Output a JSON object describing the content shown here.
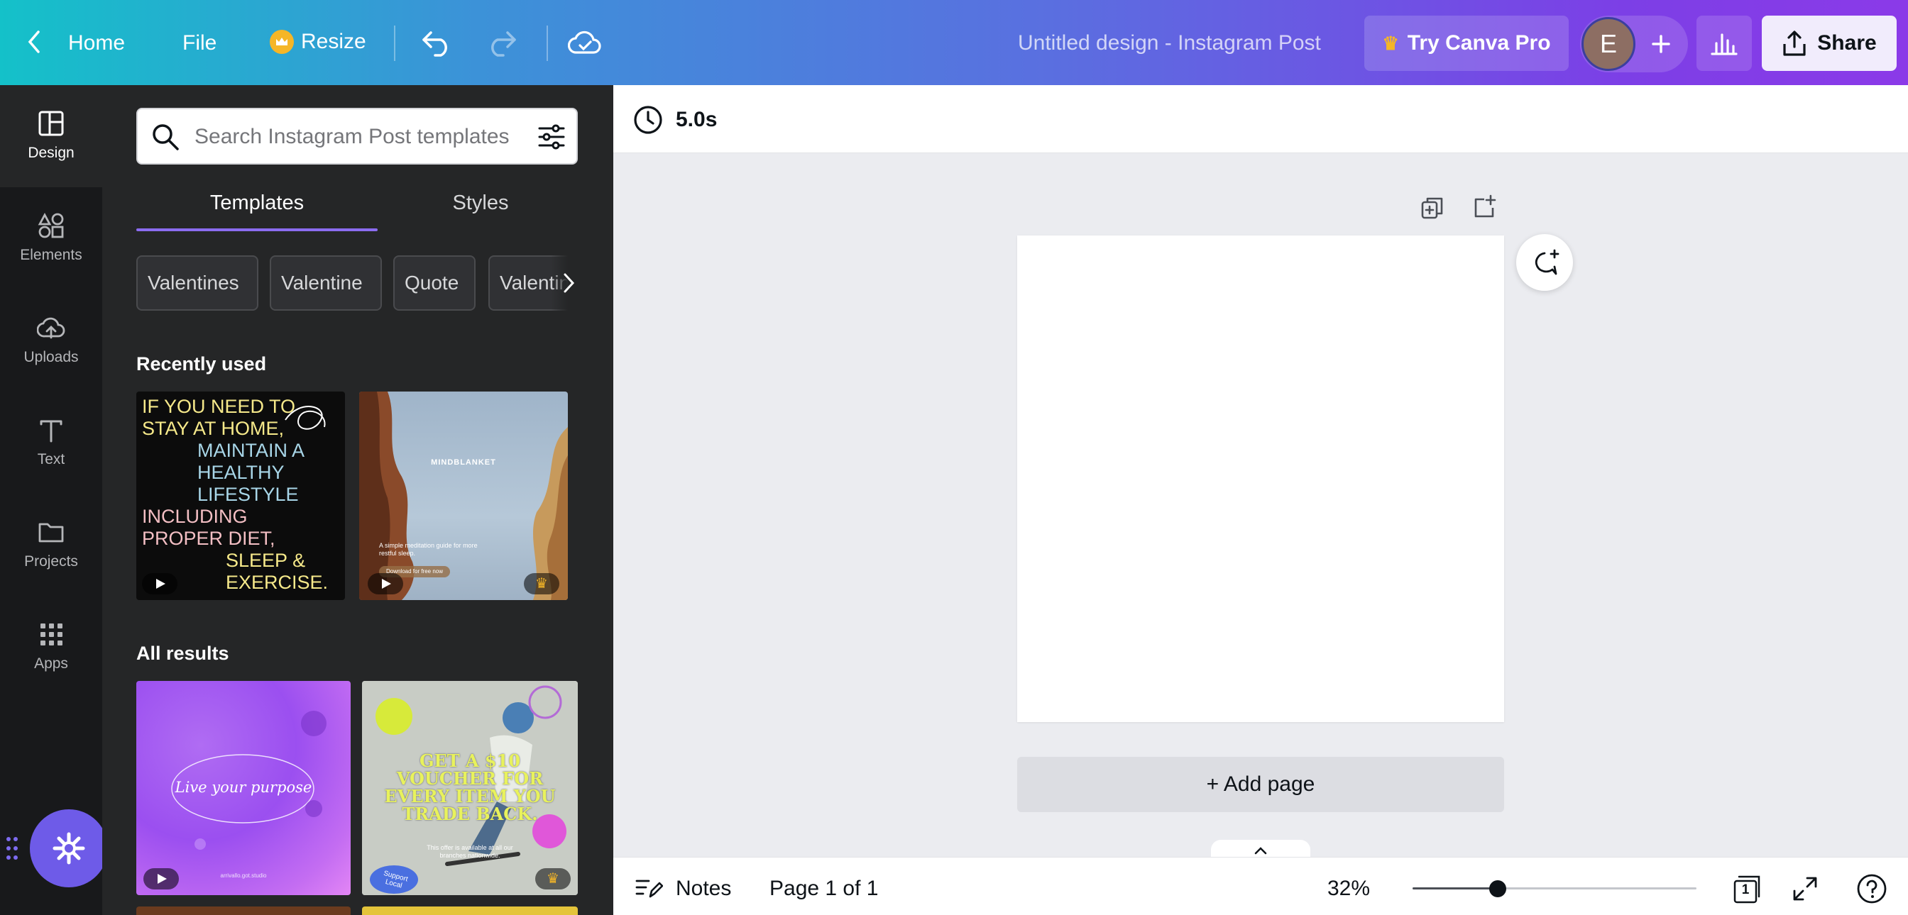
{
  "topbar": {
    "home_label": "Home",
    "file_label": "File",
    "resize_label": "Resize",
    "doc_title": "Untitled design - Instagram Post",
    "try_pro_label": "Try Canva Pro",
    "avatar_initial": "E",
    "share_label": "Share"
  },
  "rail": {
    "items": [
      {
        "label": "Design",
        "icon": "layout-icon"
      },
      {
        "label": "Elements",
        "icon": "shapes-icon"
      },
      {
        "label": "Uploads",
        "icon": "cloud-upload-icon"
      },
      {
        "label": "Text",
        "icon": "text-icon"
      },
      {
        "label": "Projects",
        "icon": "folder-icon"
      },
      {
        "label": "Apps",
        "icon": "grid-icon"
      }
    ]
  },
  "panel": {
    "search_placeholder": "Search Instagram Post templates",
    "tabs": [
      "Templates",
      "Styles"
    ],
    "chips": [
      "Valentines",
      "Valentine",
      "Quote",
      "Valentin"
    ],
    "recently_used_title": "Recently used",
    "all_results_title": "All results",
    "thumb1_lines": [
      "IF YOU NEED TO",
      "STAY AT HOME,",
      "MAINTAIN A",
      "HEALTHY",
      "LIFESTYLE",
      "INCLUDING",
      "PROPER DIET,",
      "SLEEP &",
      "EXERCISE."
    ],
    "thumb2_title": "MINDBLANKET",
    "thumb2_sub": "A simple meditation guide for more restful sleep.",
    "thumb2_btn": "Download for free now",
    "thumb3_text": "Live your purpose",
    "thumb3_small": "arrivallo.got.studio",
    "thumb4_lines": [
      "GET A $10",
      "VOUCHER FOR",
      "EVERY ITEM YOU",
      "TRADE BACK."
    ],
    "thumb4_small": "This offer is available at all our branches nationwide.",
    "thumb4_badge": "Support Local"
  },
  "editor": {
    "duration": "5.0s",
    "add_page_label": "+ Add page"
  },
  "footer": {
    "notes_label": "Notes",
    "page_label": "Page 1 of 1",
    "zoom": "32%",
    "zoom_fraction": 0.3,
    "page_count": "1"
  },
  "colors": {
    "accent_purple": "#7d2ae8",
    "panel_bg": "#252627",
    "rail_bg": "#18191b",
    "crown": "#f5b627"
  }
}
